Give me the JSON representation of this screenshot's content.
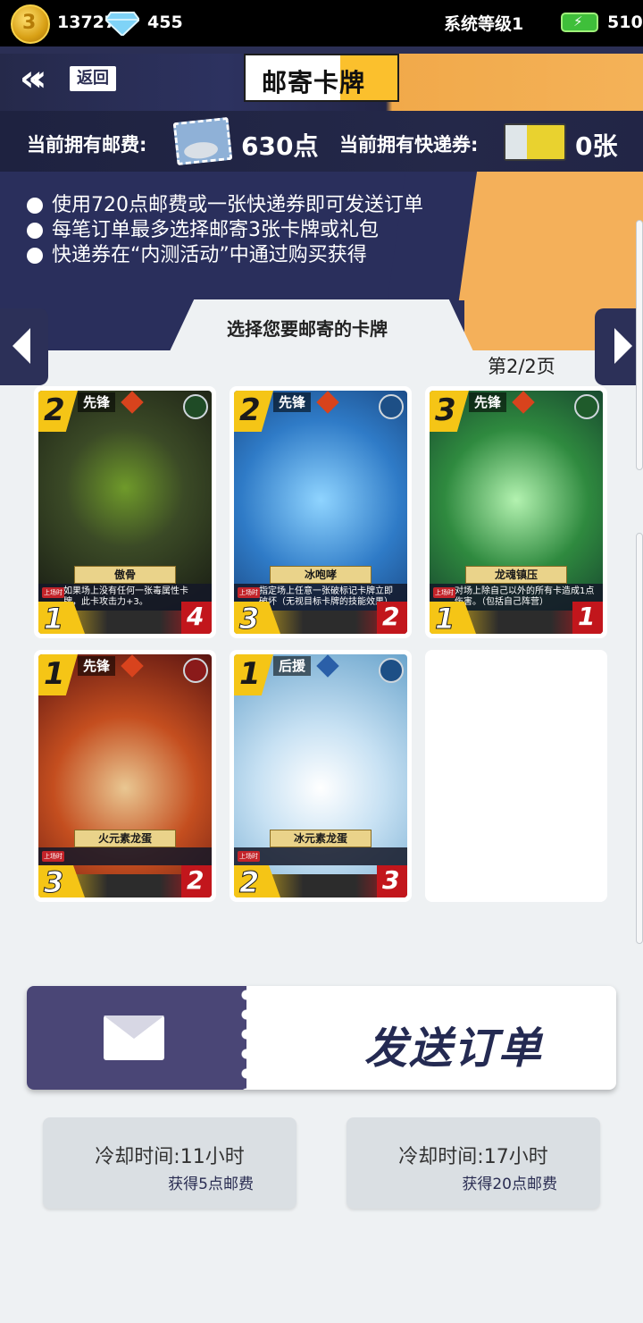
{
  "topbar": {
    "coin_symbol": "3",
    "coins": "13727",
    "gems": "455",
    "system_level": "系统等级1",
    "energy": "510"
  },
  "header": {
    "back_label": "返回",
    "title": "邮寄卡牌"
  },
  "postage": {
    "postage_label": "当前拥有邮费:",
    "postage_value": "630点",
    "express_label": "当前拥有快递券:",
    "express_value": "0张"
  },
  "info": {
    "lines": [
      "使用720点邮费或一张快递券即可发送订单",
      "每笔订单最多选择邮寄3张卡牌或礼包",
      "快递券在“内测活动”中通过购买获得"
    ]
  },
  "selector": {
    "title": "选择您要邮寄的卡牌",
    "page": "第2/2页"
  },
  "cards": [
    {
      "cost": "2",
      "type": "先锋",
      "name": "傲骨",
      "trigger": "上场时",
      "desc": "如果场上没有任何一张毒属性卡牌，此卡攻击力+3。",
      "attack": "1",
      "hp": "4"
    },
    {
      "cost": "2",
      "type": "先锋",
      "name": "冰咆哮",
      "trigger": "上场时",
      "desc": "指定场上任意一张破标记卡牌立即破坏（无视目标卡牌的技能效果）",
      "attack": "3",
      "hp": "2"
    },
    {
      "cost": "3",
      "type": "先锋",
      "name": "龙魂镇压",
      "trigger": "上场时",
      "desc": "对场上除自己以外的所有卡造成1点伤害。（包括自己阵营）",
      "attack": "1",
      "hp": "1"
    },
    {
      "cost": "1",
      "type": "先锋",
      "name": "火元素龙蛋",
      "trigger": "上场时",
      "desc": "",
      "attack": "3",
      "hp": "2"
    },
    {
      "cost": "1",
      "type": "后援",
      "name": "冰元素龙蛋",
      "trigger": "上场时",
      "desc": "",
      "attack": "2",
      "hp": "3"
    }
  ],
  "send_button": {
    "label": "发送订单"
  },
  "cooldowns": [
    {
      "time": "冷却时间:11小时",
      "reward": "获得5点邮费"
    },
    {
      "time": "冷却时间:17小时",
      "reward": "获得20点邮费"
    }
  ],
  "colors": {
    "navy": "#2a2f5c",
    "orange": "#f4b05a",
    "card_gold": "#f5c516",
    "card_red": "#c2161c"
  }
}
